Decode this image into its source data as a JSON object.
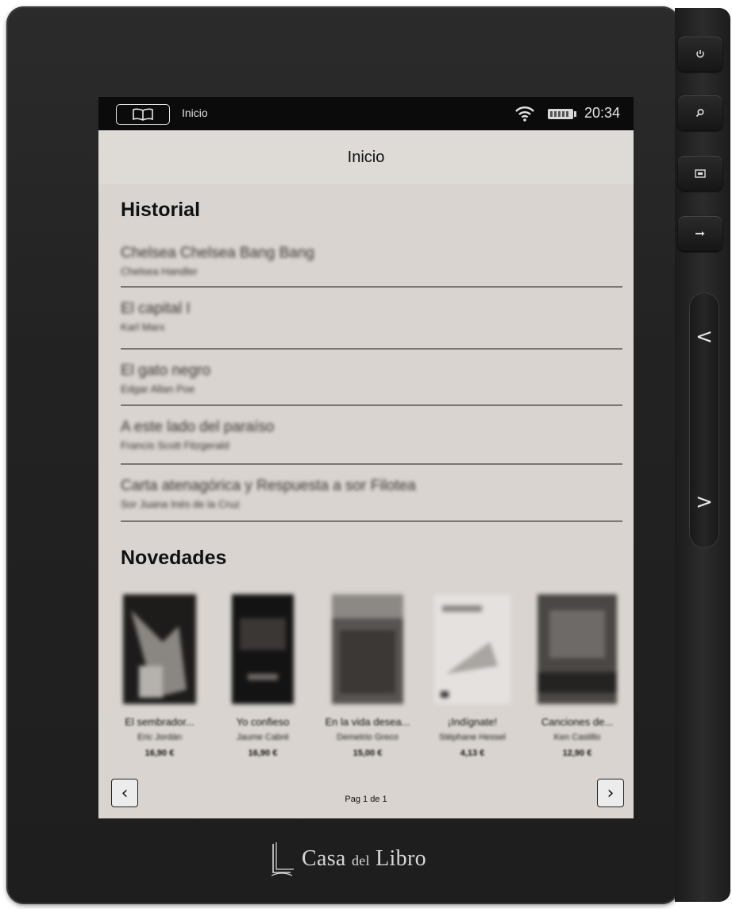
{
  "statusbar": {
    "location": "Inicio",
    "time": "20:34",
    "icons": [
      "book-icon",
      "wifi-icon",
      "battery-icon"
    ]
  },
  "header": {
    "title": "Inicio"
  },
  "historial": {
    "title": "Historial",
    "items": [
      {
        "title": "Chelsea Chelsea Bang Bang",
        "author": "Chelsea Handler"
      },
      {
        "title": "El capital I",
        "author": "Karl Marx"
      },
      {
        "title": "El gato negro",
        "author": "Edgar Allan Poe"
      },
      {
        "title": "A este lado del paraíso",
        "author": "Francis Scott Fitzgerald"
      },
      {
        "title": "Carta atenagórica y Respuesta a sor Filotea",
        "author": "Sor Juana Inés de la Cruz"
      }
    ]
  },
  "novedades": {
    "title": "Novedades",
    "books": [
      {
        "title": "El sembrador...",
        "author": "Eric Jordán",
        "price": "16,90 €"
      },
      {
        "title": "Yo confieso",
        "author": "Jaume Cabré",
        "price": "16,90 €"
      },
      {
        "title": "En la vida desea...",
        "author": "Demetrio Greco",
        "price": "15,00 €"
      },
      {
        "title": "¡Indígnate!",
        "author": "Stéphane Hessel",
        "price": "4,13 €"
      },
      {
        "title": "Canciones de...",
        "author": "Ken Castillo",
        "price": "12,90 €"
      }
    ]
  },
  "pager": {
    "text": "Pag 1 de 1",
    "prev": "‹",
    "next": "›"
  },
  "device": {
    "brand_main": "Casa",
    "brand_small": "del",
    "brand_end": "Libro",
    "buttons": [
      "power-icon",
      "search-icon",
      "menu-icon",
      "back-arrow-icon"
    ],
    "page_prev": "<",
    "page_next": ">"
  }
}
